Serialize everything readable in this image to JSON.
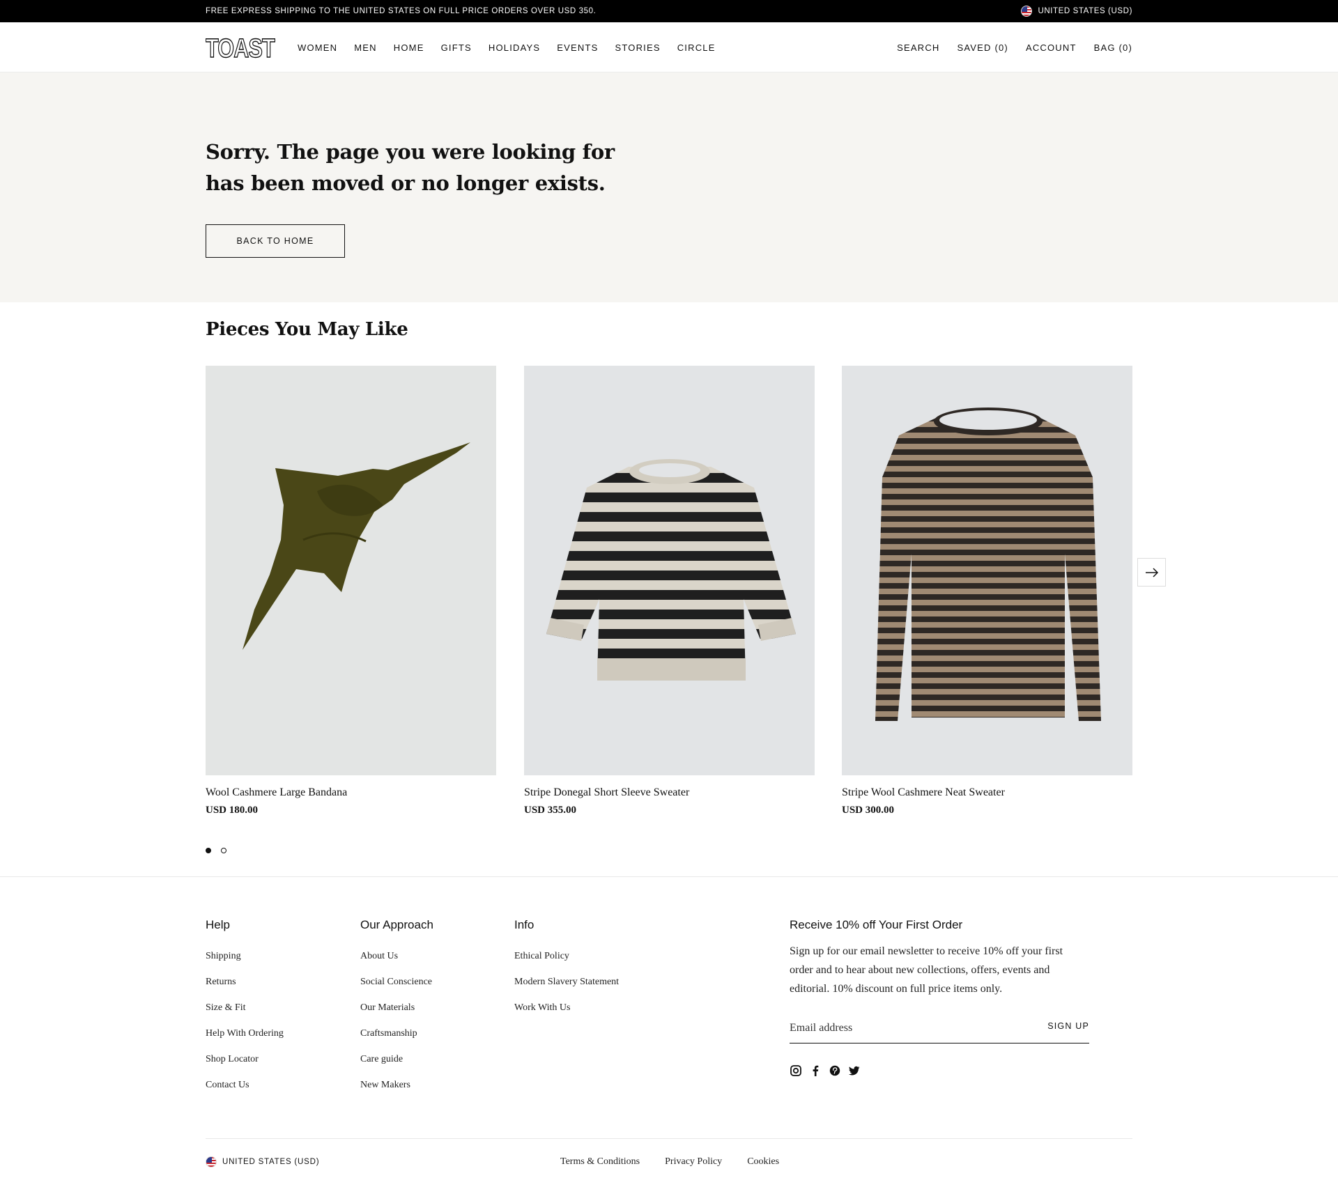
{
  "announcement": {
    "message": "FREE EXPRESS SHIPPING TO THE UNITED STATES ON FULL PRICE ORDERS OVER USD 350.",
    "region": "UNITED STATES (USD)"
  },
  "header": {
    "logo_text": "TOAST",
    "nav": [
      "WOMEN",
      "MEN",
      "HOME",
      "GIFTS",
      "HOLIDAYS",
      "EVENTS",
      "STORIES",
      "CIRCLE"
    ],
    "utilities": {
      "search": "SEARCH",
      "saved": "SAVED (0)",
      "account": "ACCOUNT",
      "bag": "BAG (0)"
    }
  },
  "hero": {
    "heading": "Sorry. The page you were looking for has been moved or no longer exists.",
    "button": "BACK TO HOME"
  },
  "recommendations": {
    "title": "Pieces You May Like",
    "products": [
      {
        "name": "Wool Cashmere Large Bandana",
        "price": "USD 180.00",
        "image": "olive-bandana"
      },
      {
        "name": "Stripe Donegal Short Sleeve Sweater",
        "price": "USD 355.00",
        "image": "black-cream-stripe-sweater"
      },
      {
        "name": "Stripe Wool Cashmere Neat Sweater",
        "price": "USD 300.00",
        "image": "brown-stripe-sweater"
      }
    ],
    "next_icon": "arrow-right-icon",
    "pagination": {
      "pages": 2,
      "current": 1
    }
  },
  "footer": {
    "help": {
      "title": "Help",
      "links": [
        "Shipping",
        "Returns",
        "Size & Fit",
        "Help With Ordering",
        "Shop Locator",
        "Contact Us"
      ]
    },
    "approach": {
      "title": "Our Approach",
      "links": [
        "About Us",
        "Social Conscience",
        "Our Materials",
        "Craftsmanship",
        "Care guide",
        "New Makers"
      ]
    },
    "info": {
      "title": "Info",
      "links": [
        "Ethical Policy",
        "Modern Slavery Statement",
        "Work With Us"
      ]
    },
    "newsletter": {
      "title": "Receive 10% off Your First Order",
      "text": "Sign up for our email newsletter to receive 10% off your first order and to hear about new collections, offers, events and editorial. 10% discount on full price items only.",
      "placeholder": "Email address",
      "button": "SIGN UP"
    },
    "socials": [
      "instagram-icon",
      "facebook-icon",
      "pinterest-icon",
      "twitter-icon"
    ],
    "region": "UNITED STATES (USD)",
    "legal": [
      "Terms & Conditions",
      "Privacy Policy",
      "Cookies"
    ]
  },
  "colors": {
    "announcement_bg": "#000000",
    "hero_bg": "#f6f5f2",
    "text": "#111111",
    "product_bg": "#e4e6e7"
  }
}
